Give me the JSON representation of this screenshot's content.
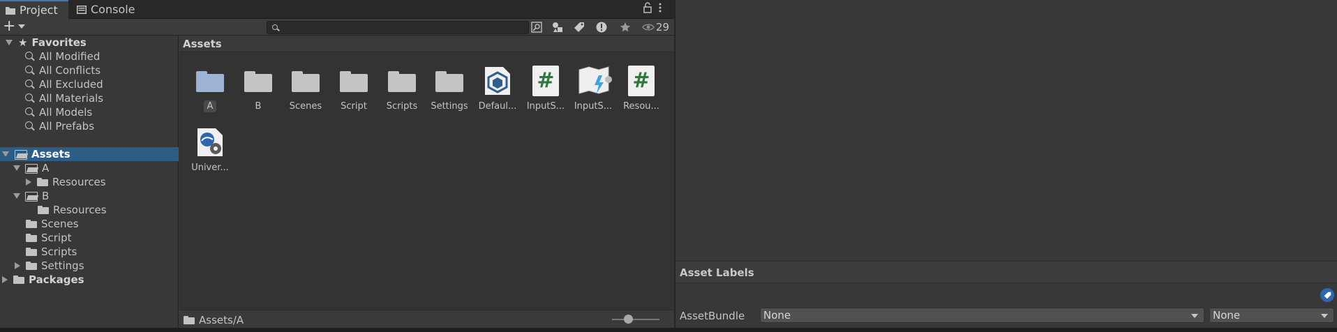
{
  "tabs": [
    {
      "label": "Project",
      "icon": "folder-icon",
      "active": true
    },
    {
      "label": "Console",
      "icon": "console-icon",
      "active": false
    }
  ],
  "toolbar": {
    "add_label": "+",
    "search_placeholder": "",
    "hidden_count": "29"
  },
  "tree": {
    "favorites_label": "Favorites",
    "favorites": [
      "All Modified",
      "All Conflicts",
      "All Excluded",
      "All Materials",
      "All Models",
      "All Prefabs"
    ],
    "assets_label": "Assets",
    "a_label": "A",
    "a_resources": "Resources",
    "b_label": "B",
    "b_resources": "Resources",
    "scenes": "Scenes",
    "script": "Script",
    "scripts": "Scripts",
    "settings": "Settings",
    "packages_label": "Packages"
  },
  "assets": {
    "header": "Assets",
    "items": [
      {
        "label": "A",
        "kind": "folder",
        "selected": true
      },
      {
        "label": "B",
        "kind": "folder"
      },
      {
        "label": "Scenes",
        "kind": "folder"
      },
      {
        "label": "Script",
        "kind": "folder"
      },
      {
        "label": "Scripts",
        "kind": "folder"
      },
      {
        "label": "Settings",
        "kind": "folder"
      },
      {
        "label": "Defaul...",
        "kind": "package"
      },
      {
        "label": "InputS...",
        "kind": "script"
      },
      {
        "label": "InputS...",
        "kind": "input-actions"
      },
      {
        "label": "Resou...",
        "kind": "script"
      },
      {
        "label": "Univer...",
        "kind": "render-pipeline"
      }
    ],
    "footer_path": "Assets/A"
  },
  "inspector": {
    "asset_labels_title": "Asset Labels",
    "assetbundle_label": "AssetBundle",
    "bundle_name": "None",
    "bundle_variant": "None"
  }
}
